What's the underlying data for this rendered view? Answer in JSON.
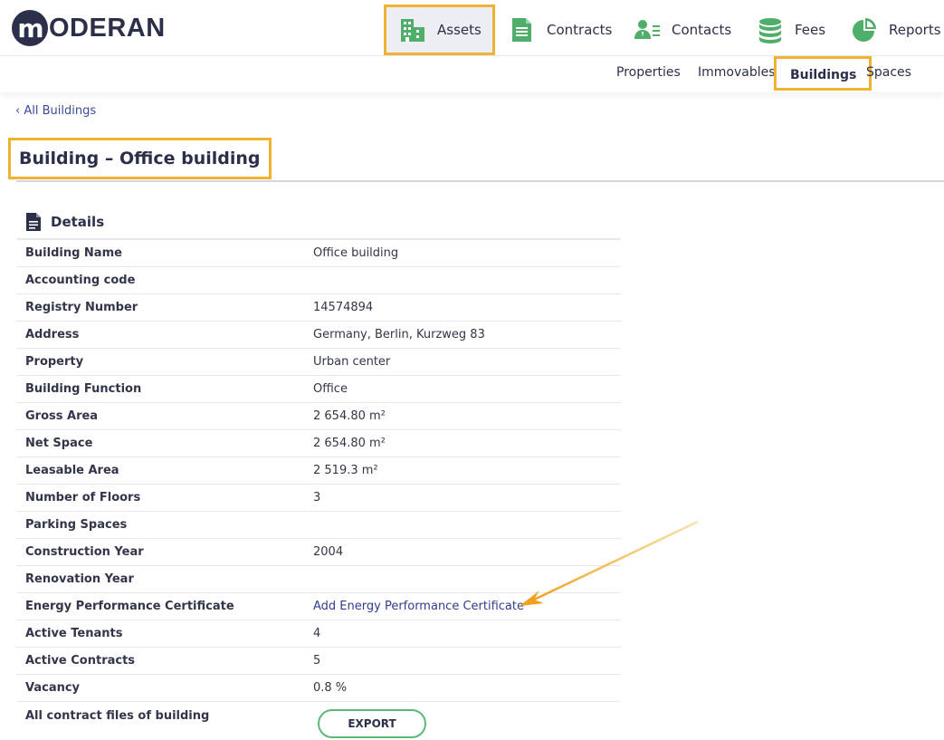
{
  "app": {
    "logo_mark": "m",
    "logo_text": "ODERAN"
  },
  "main_nav": [
    {
      "key": "assets",
      "label": "Assets",
      "icon": "building-icon",
      "active": true
    },
    {
      "key": "contracts",
      "label": "Contracts",
      "icon": "document-icon",
      "active": false
    },
    {
      "key": "contacts",
      "label": "Contacts",
      "icon": "contact-card-icon",
      "active": false
    },
    {
      "key": "fees",
      "label": "Fees",
      "icon": "coin-stack-icon",
      "active": false
    },
    {
      "key": "reports",
      "label": "Reports",
      "icon": "pie-chart-icon",
      "active": false
    }
  ],
  "sub_nav": [
    {
      "key": "properties",
      "label": "Properties",
      "active": false
    },
    {
      "key": "immovables",
      "label": "Immovables",
      "active": false
    },
    {
      "key": "buildings",
      "label": "Buildings",
      "active": true
    },
    {
      "key": "spaces",
      "label": "Spaces",
      "active": false
    }
  ],
  "back_link": "All Buildings",
  "page_title": "Building – Office building",
  "section": {
    "title": "Details",
    "icon": "document-icon"
  },
  "details": [
    {
      "label": "Building Name",
      "value": "Office building"
    },
    {
      "label": "Accounting code",
      "value": ""
    },
    {
      "label": "Registry Number",
      "value": "14574894"
    },
    {
      "label": "Address",
      "value": "Germany, Berlin, Kurzweg 83"
    },
    {
      "label": "Property",
      "value": "Urban center"
    },
    {
      "label": "Building Function",
      "value": "Office"
    },
    {
      "label": "Gross Area",
      "value": "2 654.80 m²"
    },
    {
      "label": "Net Space",
      "value": "2 654.80 m²"
    },
    {
      "label": "Leasable Area",
      "value": "2 519.3 m²"
    },
    {
      "label": "Number of Floors",
      "value": "3"
    },
    {
      "label": "Parking Spaces",
      "value": ""
    },
    {
      "label": "Construction Year",
      "value": "2004"
    },
    {
      "label": "Renovation Year",
      "value": ""
    },
    {
      "label": "Energy Performance Certificate",
      "value": "Add Energy Performance Certificate",
      "link": true
    },
    {
      "label": "Active Tenants",
      "value": "4"
    },
    {
      "label": "Active Contracts",
      "value": "5"
    },
    {
      "label": "Vacancy",
      "value": "0.8 %"
    },
    {
      "label": "All contract files of building",
      "value": ""
    }
  ],
  "export_label": "EXPORT",
  "colors": {
    "accent_highlight": "#f0b232",
    "icon_green": "#4fae6a",
    "text_dark": "#2c2f4a",
    "link": "#2f3d8f"
  }
}
